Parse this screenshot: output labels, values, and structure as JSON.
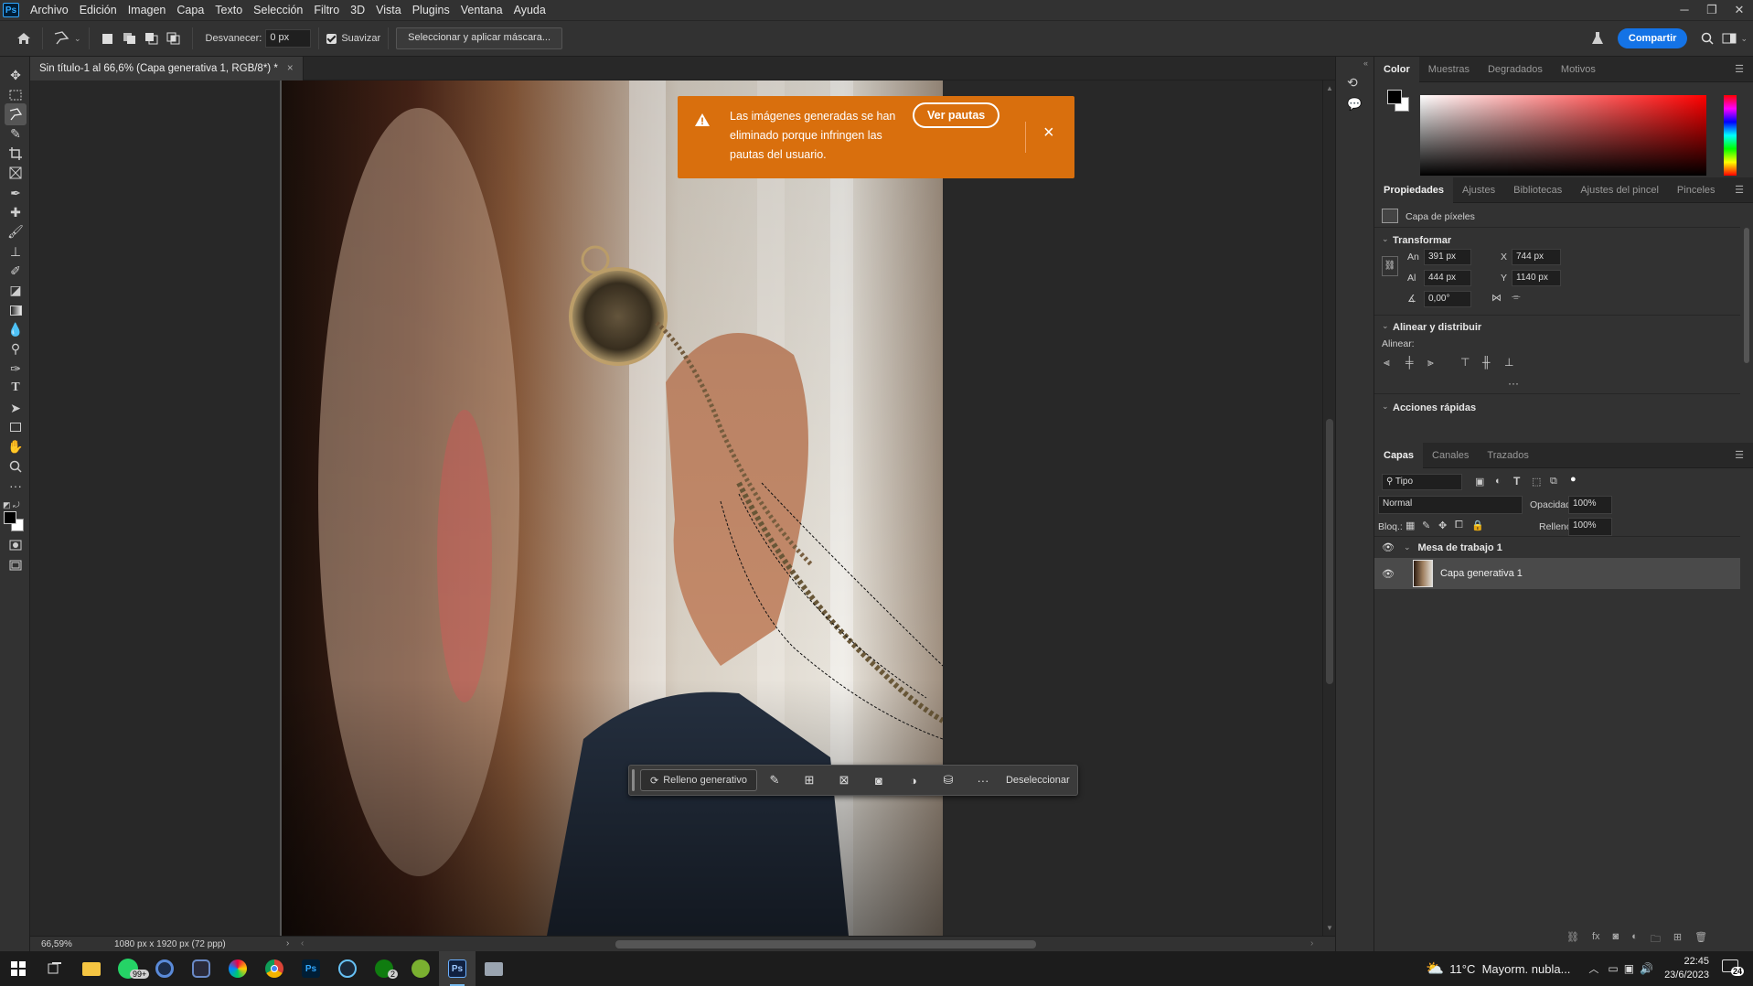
{
  "menubar": {
    "app_badge": "Ps",
    "items": [
      "Archivo",
      "Edición",
      "Imagen",
      "Capa",
      "Texto",
      "Selección",
      "Filtro",
      "3D",
      "Vista",
      "Plugins",
      "Ventana",
      "Ayuda"
    ]
  },
  "options_bar": {
    "feather_label": "Desvanecer:",
    "feather_value": "0 px",
    "smooth_label": "Suavizar",
    "select_mask_label": "Seleccionar y aplicar máscara...",
    "share_label": "Compartir"
  },
  "document": {
    "tab_title": "Sin título-1 al 66,6% (Capa generativa 1, RGB/8*) *",
    "close": "×"
  },
  "status": {
    "zoom": "66,59%",
    "doc_info": "1080 px x 1920 px (72 ppp)"
  },
  "toast": {
    "message": "Las imágenes generadas se han eliminado porque infringen las pautas del usuario.",
    "button": "Ver pautas",
    "close": "×",
    "bg_color": "#d96f0d"
  },
  "context_bar": {
    "generative_fill": "Relleno generativo",
    "deselect": "Deseleccionar"
  },
  "color_panel": {
    "tabs": [
      "Color",
      "Muestras",
      "Degradados",
      "Motivos"
    ]
  },
  "properties_panel": {
    "tabs": [
      "Propiedades",
      "Ajustes",
      "Bibliotecas",
      "Ajustes del pincel",
      "Pinceles"
    ],
    "layer_type": "Capa de píxeles",
    "transform_title": "Transformar",
    "w_label": "An",
    "w_value": "391 px",
    "h_label": "Al",
    "h_value": "444 px",
    "x_label": "X",
    "x_value": "744 px",
    "y_label": "Y",
    "y_value": "1140 px",
    "angle_value": "0,00°",
    "align_title": "Alinear y distribuir",
    "align_label": "Alinear:",
    "quick_actions_title": "Acciones rápidas"
  },
  "layers_panel": {
    "tabs": [
      "Capas",
      "Canales",
      "Trazados"
    ],
    "kind_filter": "Tipo",
    "blend_mode": "Normal",
    "opacity_label": "Opacidad:",
    "opacity_value": "100%",
    "lock_label": "Bloq.:",
    "fill_label": "Relleno:",
    "fill_value": "100%",
    "artboard_name": "Mesa de trabajo 1",
    "layer_name": "Capa generativa 1"
  },
  "taskbar": {
    "whatsapp_badge": "99+",
    "xbox_badge": "2",
    "weather": "11°C  Mayorm. nubla...",
    "time": "22:45",
    "date": "23/6/2023",
    "notif_count": "24"
  }
}
